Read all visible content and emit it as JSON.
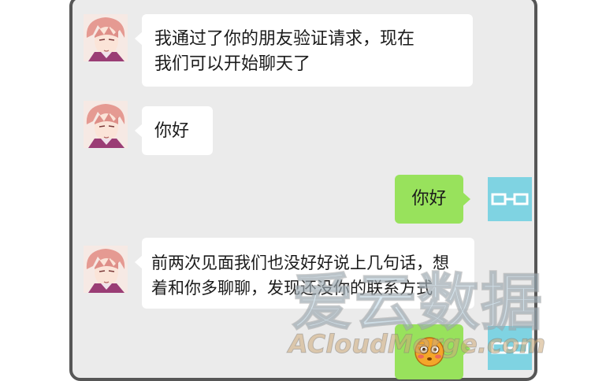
{
  "chat": {
    "messages": [
      {
        "side": "incoming",
        "lines": [
          "我通过了你的朋友验证请求，现在",
          "我们可以开始聊天了"
        ]
      },
      {
        "side": "incoming",
        "lines": [
          "你好"
        ]
      },
      {
        "side": "outgoing",
        "lines": [
          "你好"
        ]
      },
      {
        "side": "incoming",
        "lines": [
          "前两次见面我们也没好好说上几句话，想",
          "着和你多聊聊，发现还没你的联系方式"
        ]
      },
      {
        "side": "outgoing",
        "lines": [
          "😳"
        ]
      }
    ]
  },
  "watermark": {
    "chinese": "爱云数据",
    "english": "ACloudMerge.com"
  },
  "colors": {
    "chat_background": "#ebebeb",
    "incoming_bubble": "#ffffff",
    "outgoing_bubble": "#98e25c",
    "my_avatar": "#7fd3e2",
    "frame": "#565656"
  },
  "icons": {
    "other_avatar": "pink-haired-boy-avatar",
    "my_avatar": "glasses-avatar",
    "emoji": "flushed-face-emoji"
  }
}
